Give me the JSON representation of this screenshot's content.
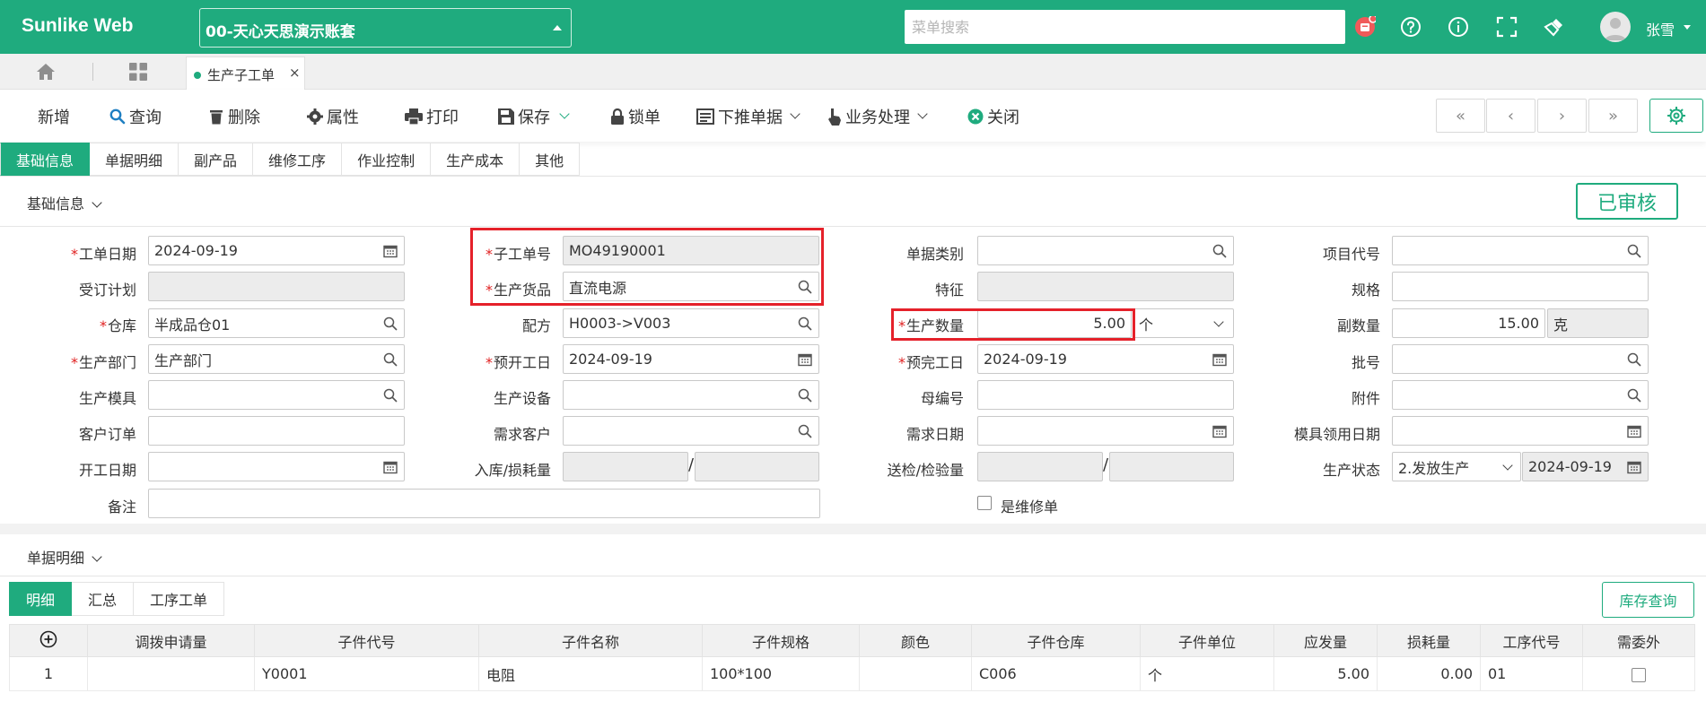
{
  "app": {
    "brand": "Sunlike Web",
    "account": "00-天心天思演示账套",
    "menu_search_placeholder": "菜单搜索",
    "user": "张雪",
    "accent": "#1fab7e"
  },
  "tabs": {
    "page_tab": "生产子工单"
  },
  "toolbar": {
    "new": "新增",
    "query": "查询",
    "delete": "删除",
    "props": "属性",
    "print": "打印",
    "save": "保存",
    "lock": "锁单",
    "push": "下推单据",
    "business": "业务处理",
    "close": "关闭",
    "first": "«",
    "prev": "‹",
    "next": "›",
    "last": "»"
  },
  "subtabs": [
    "基础信息",
    "单据明细",
    "副产品",
    "维修工序",
    "作业控制",
    "生产成本",
    "其他"
  ],
  "basic": {
    "title": "基础信息",
    "status": "已审核",
    "labels": {
      "order_date": "工单日期",
      "plan": "受订计划",
      "warehouse": "仓库",
      "dept": "生产部门",
      "mold": "生产模具",
      "cust_order": "客户订单",
      "work_date": "开工日期",
      "remark": "备注",
      "sub_no": "子工单号",
      "goods": "生产货品",
      "formula": "配方",
      "pre_start": "预开工日",
      "equip": "生产设备",
      "demand_cust": "需求客户",
      "in_loss": "入库/损耗量",
      "doc_type": "单据类别",
      "feature": "特征",
      "qty": "生产数量",
      "pre_end": "预完工日",
      "parent_no": "母编号",
      "demand_date": "需求日期",
      "inspect": "送检/检验量",
      "is_repair": "是维修单",
      "project": "项目代号",
      "spec": "规格",
      "sub_qty": "副数量",
      "batch": "批号",
      "attach": "附件",
      "mold_date": "模具领用日期",
      "prod_status": "生产状态"
    },
    "values": {
      "order_date": "2024-09-19",
      "warehouse": "半成品仓01",
      "dept": "生产部门",
      "sub_no": "MO49190001",
      "goods": "直流电源",
      "formula": "H0003->V003",
      "pre_start": "2024-09-19",
      "qty": "5.00",
      "qty_unit": "个",
      "pre_end": "2024-09-19",
      "sub_qty": "15.00",
      "sub_unit": "克",
      "prod_status": "2.发放生产",
      "status_date": "2024-09-19",
      "slash": "/"
    }
  },
  "detail": {
    "title": "单据明细",
    "tabs": [
      "明细",
      "汇总",
      "工序工单"
    ],
    "stock_button": "库存查询",
    "columns": [
      "调拨申请量",
      "子件代号",
      "子件名称",
      "子件规格",
      "颜色",
      "子件仓库",
      "子件单位",
      "应发量",
      "损耗量",
      "工序代号",
      "需委外"
    ],
    "rows": [
      {
        "idx": "1",
        "transfer": "",
        "code": "Y0001",
        "name": "电阻",
        "spec": "100*100",
        "color": "",
        "wh": "C006",
        "unit": "个",
        "issue": "5.00",
        "loss": "0.00",
        "proc": "01"
      }
    ]
  }
}
